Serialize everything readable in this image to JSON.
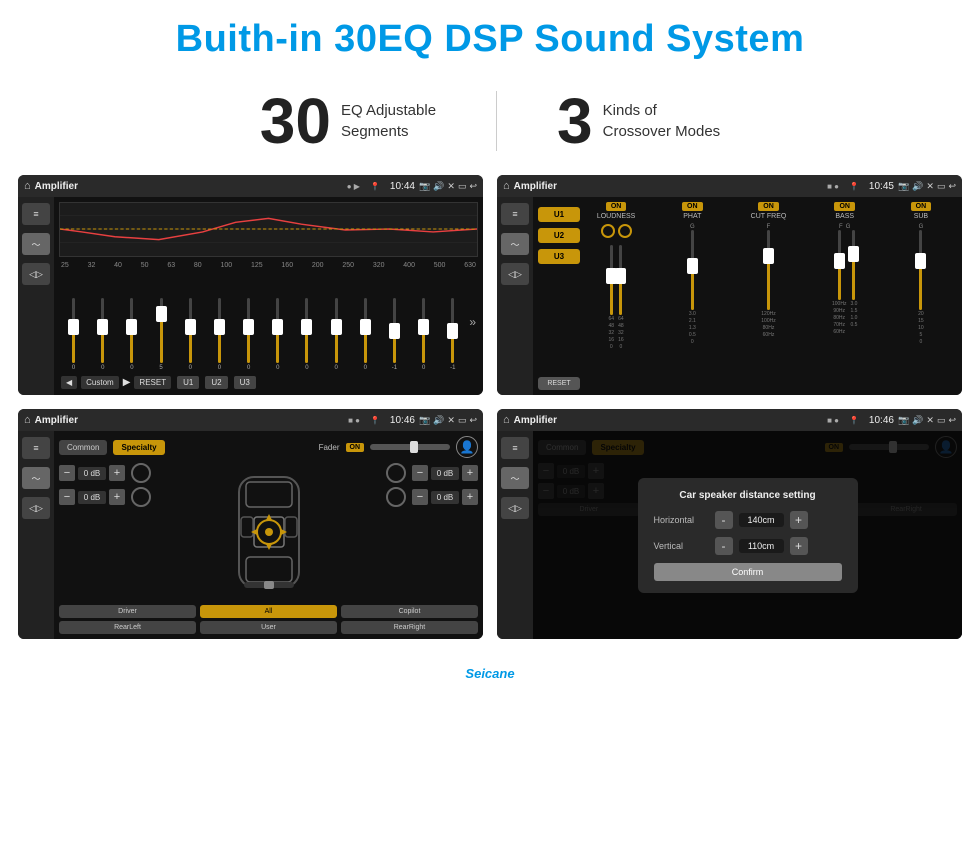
{
  "header": {
    "title": "Buith-in 30EQ DSP Sound System"
  },
  "stats": {
    "eq_number": "30",
    "eq_label_line1": "EQ Adjustable",
    "eq_label_line2": "Segments",
    "crossover_number": "3",
    "crossover_label_line1": "Kinds of",
    "crossover_label_line2": "Crossover Modes"
  },
  "screens": {
    "screen1": {
      "title": "Amplifier",
      "time": "10:44",
      "freq_labels": [
        "25",
        "32",
        "40",
        "50",
        "63",
        "80",
        "100",
        "125",
        "160",
        "200",
        "250",
        "320",
        "400",
        "500",
        "630"
      ],
      "bottom_buttons": [
        "Custom",
        "RESET",
        "U1",
        "U2",
        "U3"
      ],
      "slider_values": [
        "0",
        "0",
        "0",
        "5",
        "0",
        "0",
        "0",
        "0",
        "0",
        "0",
        "0",
        "-1",
        "0",
        "-1"
      ]
    },
    "screen2": {
      "title": "Amplifier",
      "time": "10:45",
      "presets": [
        "U1",
        "U2",
        "U3"
      ],
      "channels": [
        "LOUDNESS",
        "PHAT",
        "CUT FREQ",
        "BASS",
        "SUB"
      ],
      "on_label": "ON",
      "reset_label": "RESET"
    },
    "screen3": {
      "title": "Amplifier",
      "time": "10:46",
      "tabs": [
        "Common",
        "Specialty"
      ],
      "fader_label": "Fader",
      "on_label": "ON",
      "db_values": [
        "0 dB",
        "0 dB",
        "0 dB",
        "0 dB"
      ],
      "bottom_buttons": [
        "Driver",
        "All",
        "Copilot",
        "RearLeft",
        "User",
        "RearRight"
      ]
    },
    "screen4": {
      "title": "Amplifier",
      "time": "10:46",
      "tabs": [
        "Common",
        "Specialty"
      ],
      "on_label": "ON",
      "dialog": {
        "title": "Car speaker distance setting",
        "horizontal_label": "Horizontal",
        "horizontal_value": "140cm",
        "vertical_label": "Vertical",
        "vertical_value": "110cm",
        "confirm_label": "Confirm",
        "minus_label": "-",
        "plus_label": "+"
      },
      "db_values": [
        "0 dB",
        "0 dB"
      ],
      "bottom_buttons": [
        "Driver",
        "RearLeft",
        "Copilot",
        "RearRight"
      ],
      "bottom_all": "All",
      "bottom_user": "User"
    }
  },
  "watermark": "Seicane"
}
